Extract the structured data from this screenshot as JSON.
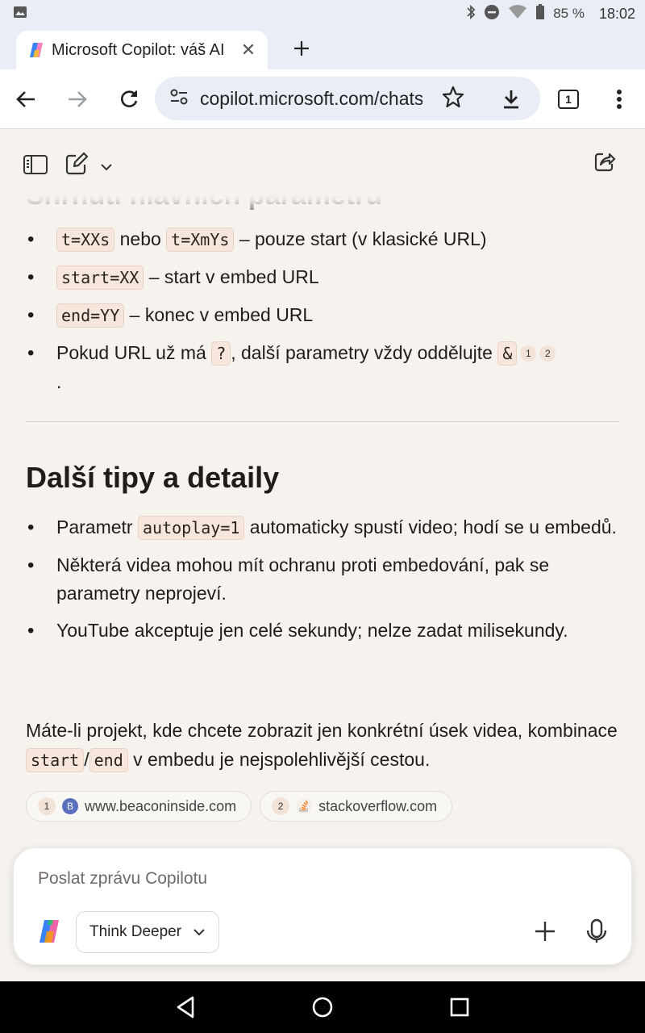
{
  "status_bar": {
    "battery": "85 %",
    "time": "18:02"
  },
  "tab": {
    "title": "Microsoft Copilot: váš AI",
    "close": "✕"
  },
  "toolbar": {
    "url": "copilot.microsoft.com/chats",
    "tab_count": "1"
  },
  "content": {
    "partial_heading": "Shrnutí hlavních parametrů",
    "summary_items": [
      {
        "code1": "t=XXs",
        "mid": "nebo",
        "code2": "t=XmYs",
        "text": "– pouze start (v klasické URL)"
      },
      {
        "code": "start=XX",
        "text": "– start v embed URL"
      },
      {
        "code": "end=YY",
        "text": "– konec v embed URL"
      },
      {
        "pre": "Pokud URL už má",
        "code1": "?",
        "mid": ", další parametry vždy oddělujte",
        "code2": "&",
        "cite1": "1",
        "cite2": "2",
        "end": "."
      }
    ],
    "tips_heading": "Další tipy a detaily",
    "tips": [
      {
        "pre": "Parametr",
        "code": "autoplay=1",
        "text": "automaticky spustí video; hodí se u embedů."
      },
      {
        "text": "Některá videa mohou mít ochranu proti embedování, pak se parametry neprojeví."
      },
      {
        "text": "YouTube akceptuje jen celé sekundy; nelze zadat milisekundy."
      }
    ],
    "closing": {
      "pre": "Máte-li projekt, kde chcete zobrazit jen konkrétní úsek videa, kombinace",
      "code1": "start",
      "sep": "/",
      "code2": "end",
      "post": "v embedu je nejspolehlivější cestou."
    },
    "sources": [
      {
        "num": "1",
        "label": "www.beaconinside.com"
      },
      {
        "num": "2",
        "label": "stackoverflow.com"
      }
    ]
  },
  "composer": {
    "placeholder": "Poslat zprávu Copilotu",
    "mode": "Think Deeper"
  },
  "colors": {
    "accent": "#f6e6dc",
    "background": "#f6f3ef",
    "chrome": "#e9eef6"
  }
}
